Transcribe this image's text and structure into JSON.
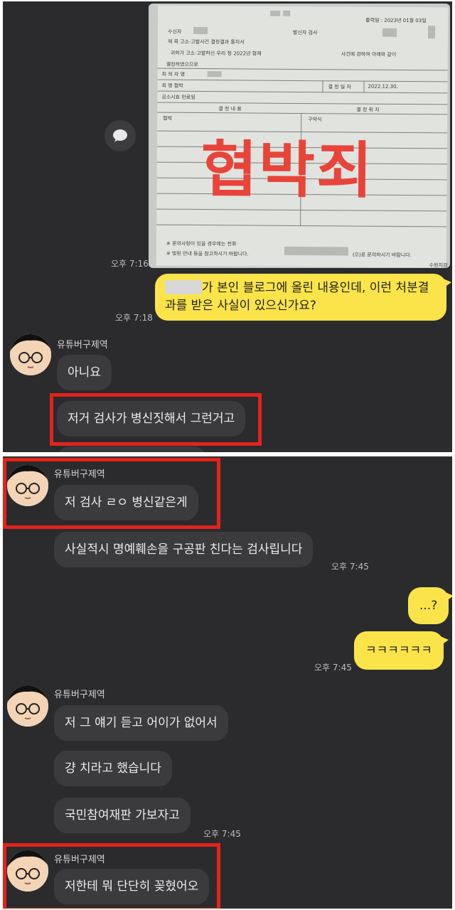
{
  "panel1": {
    "photo": {
      "stamp_text": "협박죄",
      "fields": {
        "issue_date": "출력일 : 2023년 01월 03일",
        "recipient": "수신자",
        "sender": "발신자  검사",
        "subject": "제  목  고소·고발사건 결정결과 통지서",
        "intro": "귀하가 고소·고발하신 우리 청 2022년 형제",
        "intro2": "사건에 관하여 아래와 같이",
        "result_label": "결정하였으므로",
        "suspect": "피 의 자 명",
        "crime": "죄   명   협박",
        "decision_date_label": "결 정 일 자",
        "decision_date": "2022.12.30.",
        "case_no": "공소시효 만료일",
        "decision_content": "결  정  내  용",
        "reason": "결  정  취  지",
        "left_col": "협박",
        "right_col": "구약식",
        "footer1": "※ 문의사항이 있을 경우에는 전화",
        "footer2": "※ 빛된 안내 등을 참고하시기 바랍니다.",
        "footer3": "(으)로 문의하시기 바랍니다.",
        "stamp_corner": "수원지검"
      }
    },
    "msg_photo_time": "오후 7:16",
    "msg_out_line1": "가 본인 블로그에 올린 내용인데, 이런 처분결",
    "msg_out_line2": "과를 받은 사실이 있으신가요?",
    "msg_out_time": "오후 7:18",
    "sender": "유튜버구제역",
    "reply1": "아니요",
    "reply2": "저거 검사가 병신짓해서 그런거고"
  },
  "panel2": {
    "sender": "유튜버구제역",
    "msg1": "저 검사 ㄹㅇ 병신같은게",
    "msg2": "사실적시 명예훼손을 구공판 친다는 검사립니다",
    "msg2_time": "오후 7:45",
    "out1": "...?",
    "out2": "ㅋㅋㅋㅋㅋㅋ",
    "out_time": "오후 7:45",
    "sender2": "유튜버구제역",
    "msg3": "저 그 얘기 듣고 어이가 없어서",
    "msg4": "걍 치라고 했습니다",
    "msg5": "국민참여재판 가보자고",
    "msg5_time": "오후 7:45",
    "sender3": "유튜버구제역",
    "msg6": "저한테 뭐 단단히 꽂혔어오"
  },
  "colors": {
    "background": "#2b2b2d",
    "incoming_bubble": "#3b3b3e",
    "outgoing_bubble": "#fbe44a",
    "highlight_box": "#e2231a",
    "stamp": "#e8443a"
  }
}
